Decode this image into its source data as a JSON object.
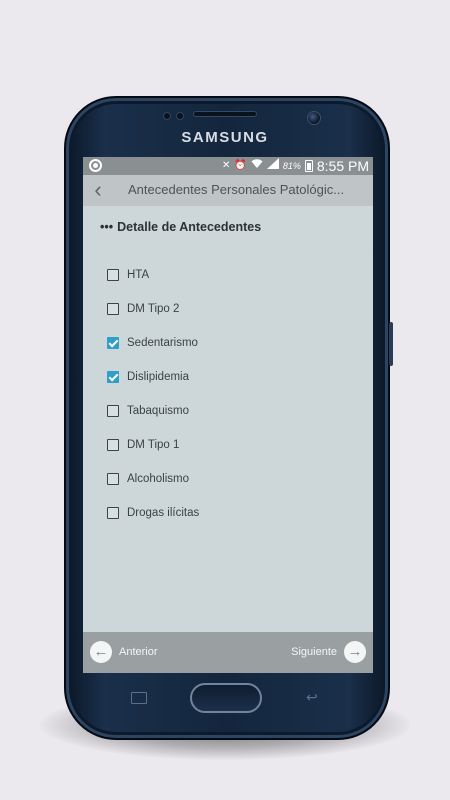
{
  "device": {
    "brand": "SAMSUNG"
  },
  "status_bar": {
    "battery_percent": "81%",
    "time": "8:55 PM",
    "icons": [
      "app-notification-icon",
      "mute-icon",
      "alarm-icon",
      "wifi-icon",
      "signal-icon",
      "battery-icon"
    ]
  },
  "app_bar": {
    "back_icon": "chevron-left-icon",
    "title": "Antecedentes Personales Patológic..."
  },
  "section": {
    "dots": "•••",
    "title": "Detalle de Antecedentes"
  },
  "items": [
    {
      "label": "HTA",
      "checked": false
    },
    {
      "label": "DM Tipo 2",
      "checked": false
    },
    {
      "label": "Sedentarismo",
      "checked": true
    },
    {
      "label": "Dislipidemia",
      "checked": true
    },
    {
      "label": "Tabaquismo",
      "checked": false
    },
    {
      "label": "DM Tipo 1",
      "checked": false
    },
    {
      "label": "Alcoholismo",
      "checked": false
    },
    {
      "label": "Drogas ilícitas",
      "checked": false
    }
  ],
  "bottom_bar": {
    "prev_label": "Anterior",
    "next_label": "Siguiente"
  },
  "colors": {
    "accent": "#2e9fc8",
    "screen_bg": "#cdd7d9",
    "app_bar": "#bfc5c6",
    "bottom_bar": "#9aa0a2"
  }
}
